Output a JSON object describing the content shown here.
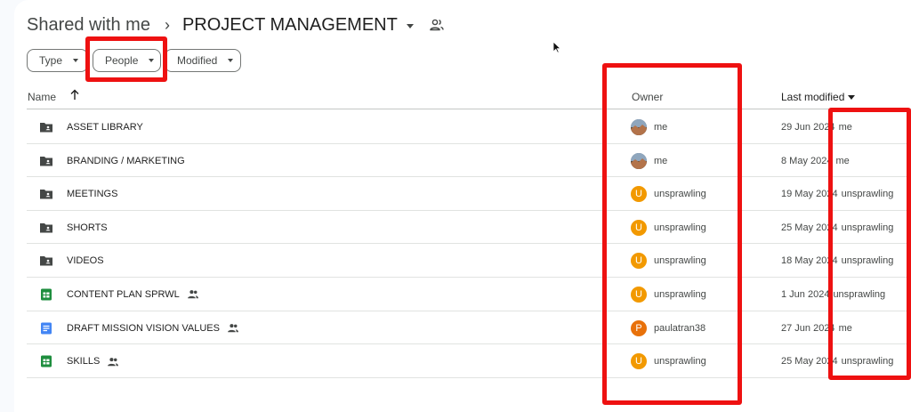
{
  "breadcrumb": {
    "root": "Shared with me",
    "separator": "›",
    "current": "PROJECT MANAGEMENT"
  },
  "filters": [
    {
      "label": "Type"
    },
    {
      "label": "People"
    },
    {
      "label": "Modified"
    }
  ],
  "columns": {
    "name": "Name",
    "owner": "Owner",
    "last_modified": "Last modified"
  },
  "colors": {
    "folder": "#444746",
    "sheets": "#1e8e3e",
    "docs": "#4285f4",
    "avatar_u": "#f29900",
    "avatar_p": "#e8710a",
    "highlight": "#ee1111"
  },
  "rows": [
    {
      "icon": "shared-folder-icon",
      "name": "ASSET LIBRARY",
      "shared": false,
      "avatar": "photo",
      "owner": "me",
      "date": "29 Jun 2024",
      "by": "me"
    },
    {
      "icon": "shared-folder-icon",
      "name": "BRANDING / MARKETING",
      "shared": false,
      "avatar": "photo",
      "owner": "me",
      "date": "8 May 2024",
      "by": "me"
    },
    {
      "icon": "shared-folder-icon",
      "name": "MEETINGS",
      "shared": false,
      "avatar": "U",
      "owner": "unsprawling",
      "date": "19 May 2024",
      "by": "unsprawling"
    },
    {
      "icon": "shared-folder-icon",
      "name": "SHORTS",
      "shared": false,
      "avatar": "U",
      "owner": "unsprawling",
      "date": "25 May 2024",
      "by": "unsprawling"
    },
    {
      "icon": "shared-folder-icon",
      "name": "VIDEOS",
      "shared": false,
      "avatar": "U",
      "owner": "unsprawling",
      "date": "18 May 2024",
      "by": "unsprawling"
    },
    {
      "icon": "sheets-icon",
      "name": "CONTENT PLAN SPRWL",
      "shared": true,
      "avatar": "U",
      "owner": "unsprawling",
      "date": "1 Jun 2024",
      "by": "unsprawling"
    },
    {
      "icon": "docs-icon",
      "name": "DRAFT MISSION VISION VALUES",
      "shared": true,
      "avatar": "P",
      "owner": "paulatran38",
      "date": "27 Jun 2024",
      "by": "me"
    },
    {
      "icon": "sheets-icon",
      "name": "SKILLS",
      "shared": true,
      "avatar": "U",
      "owner": "unsprawling",
      "date": "25 May 2024",
      "by": "unsprawling"
    }
  ]
}
